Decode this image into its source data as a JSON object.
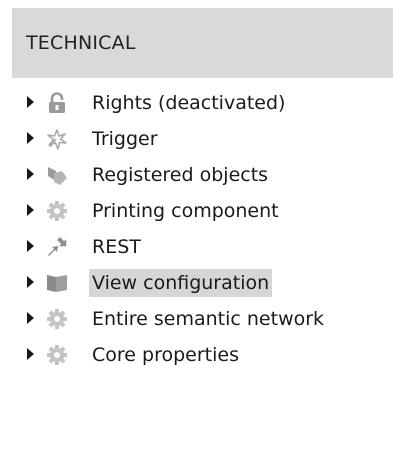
{
  "section": {
    "title": "TECHNICAL"
  },
  "tree": {
    "items": [
      {
        "label": "Rights (deactivated)",
        "icon": "padlock-icon"
      },
      {
        "label": "Trigger",
        "icon": "trigger-icon"
      },
      {
        "label": "Registered objects",
        "icon": "registered-objects-icon"
      },
      {
        "label": "Printing component",
        "icon": "gear-icon"
      },
      {
        "label": "REST",
        "icon": "rest-arrows-icon"
      },
      {
        "label": "View configuration",
        "icon": "folder-icon",
        "selected": true
      },
      {
        "label": "Entire semantic network",
        "icon": "gear-icon"
      },
      {
        "label": "Core properties",
        "icon": "gear-icon"
      }
    ]
  },
  "colors": {
    "header_bg": "#d9d9d9",
    "selection_bg": "#d6d6d6",
    "icon_gray": "#9a9a9a",
    "icon_light": "#c4c4c4",
    "text": "#1a1a1a"
  }
}
